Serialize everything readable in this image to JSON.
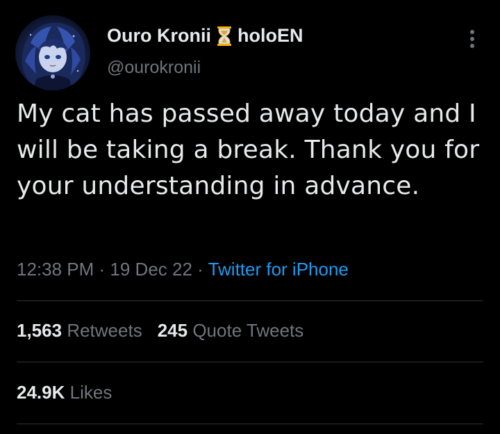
{
  "author": {
    "display_name": "Ouro Kronii",
    "name_suffix": "holoEN",
    "name_emoji": "hourglass-icon",
    "handle": "@ourokronii",
    "avatar": "avatar-image"
  },
  "tweet": {
    "text": "My cat has passed away today and I will be taking a break. Thank you for your understanding in advance."
  },
  "meta": {
    "time": "12:38 PM",
    "separator1": " · ",
    "date": "19 Dec 22",
    "separator2": " · ",
    "source": "Twitter for iPhone"
  },
  "stats": {
    "retweets_count": "1,563",
    "retweets_label": "Retweets",
    "quotes_count": "245",
    "quotes_label": "Quote Tweets",
    "likes_count": "24.9K",
    "likes_label": "Likes"
  },
  "colors": {
    "background": "#000000",
    "text": "#e7e9ea",
    "secondary": "#71767b",
    "link": "#1d9bf0",
    "divider": "#2f3336",
    "hourglass": "#f4b400"
  }
}
